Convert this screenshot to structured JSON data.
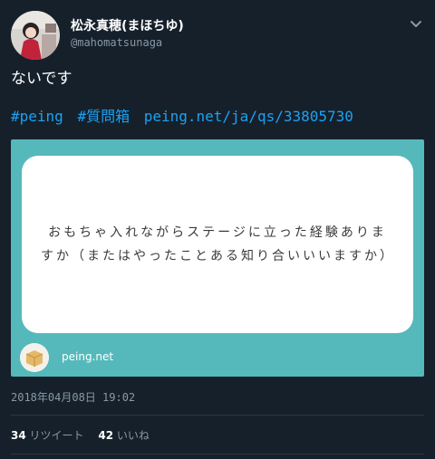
{
  "user": {
    "display_name": "松永真穂(まほちゆ)",
    "handle": "@mahomatsunaga"
  },
  "tweet": {
    "text": "ないです",
    "hashtags": [
      "#peing",
      "#質問箱"
    ],
    "link": "peing.net/ja/qs/33805730",
    "timestamp": "2018年04月08日 19:02"
  },
  "card": {
    "question": "おもちゃ入れながらステージに立った経験ありますか（またはやったことある知り合いいいますか）",
    "domain": "peing.net",
    "background_color": "#55b9bb"
  },
  "stats": {
    "retweets_count": "34",
    "retweets_label": "リツイート",
    "likes_count": "42",
    "likes_label": "いいね"
  },
  "icons": {
    "menu": "chevron-down-icon",
    "card_logo": "peing-logo-icon"
  },
  "colors": {
    "background": "#15202b",
    "link": "#1da1f2",
    "muted": "#8899a6"
  }
}
